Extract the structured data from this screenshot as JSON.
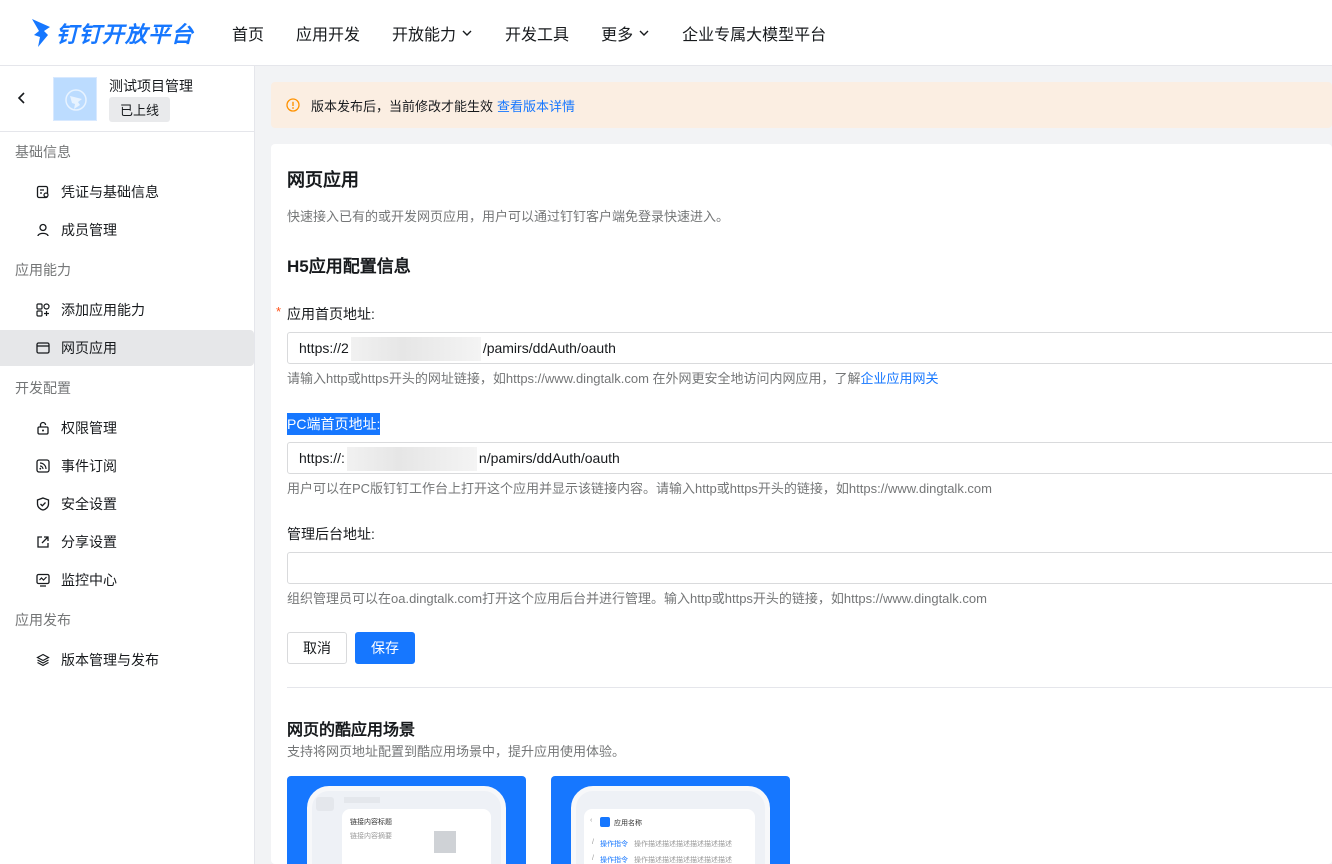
{
  "brand": {
    "name": "钉钉开放平台",
    "color": "#1677ff"
  },
  "topnav": {
    "items": [
      {
        "label": "首页",
        "dropdown": false
      },
      {
        "label": "应用开发",
        "dropdown": false
      },
      {
        "label": "开放能力",
        "dropdown": true
      },
      {
        "label": "开发工具",
        "dropdown": false
      },
      {
        "label": "更多",
        "dropdown": true
      },
      {
        "label": "企业专属大模型平台",
        "dropdown": false
      }
    ]
  },
  "sidebar": {
    "app_name": "测试项目管理",
    "app_status": "已上线",
    "groups": [
      {
        "title": "基础信息",
        "items": [
          {
            "label": "凭证与基础信息",
            "icon": "credential-icon"
          },
          {
            "label": "成员管理",
            "icon": "user-icon"
          }
        ]
      },
      {
        "title": "应用能力",
        "items": [
          {
            "label": "添加应用能力",
            "icon": "add-capability-icon"
          },
          {
            "label": "网页应用",
            "icon": "browser-icon",
            "active": true
          }
        ]
      },
      {
        "title": "开发配置",
        "items": [
          {
            "label": "权限管理",
            "icon": "lock-icon"
          },
          {
            "label": "事件订阅",
            "icon": "rss-icon"
          },
          {
            "label": "安全设置",
            "icon": "shield-icon"
          },
          {
            "label": "分享设置",
            "icon": "share-icon"
          },
          {
            "label": "监控中心",
            "icon": "monitor-icon"
          }
        ]
      },
      {
        "title": "应用发布",
        "items": [
          {
            "label": "版本管理与发布",
            "icon": "layers-icon"
          }
        ]
      }
    ]
  },
  "banner": {
    "text": "版本发布后，当前修改才能生效",
    "link": "查看版本详情"
  },
  "page": {
    "title": "网页应用",
    "desc": "快速接入已有的或开发网页应用，用户可以通过钉钉客户端免登录快速进入。",
    "section_title": "H5应用配置信息",
    "fields": {
      "home": {
        "label": "应用首页地址:",
        "value_prefix": "https://2",
        "value_suffix": "/pamirs/ddAuth/oauth",
        "hint": "请输入http或https开头的网址链接，如https://www.dingtalk.com 在外网更安全地访问内网应用，了解",
        "hint_link": "企业应用网关"
      },
      "pc": {
        "label": "PC端首页地址:",
        "value_prefix": "https://:",
        "value_suffix": "n/pamirs/ddAuth/oauth",
        "hint": "用户可以在PC版钉钉工作台上打开这个应用并显示该链接内容。请输入http或https开头的链接，如https://www.dingtalk.com"
      },
      "admin": {
        "label": "管理后台地址:",
        "value": "",
        "hint": "组织管理员可以在oa.dingtalk.com打开这个应用后台并进行管理。输入http或https开头的链接，如https://www.dingtalk.com"
      }
    },
    "buttons": {
      "cancel": "取消",
      "save": "保存"
    },
    "scene": {
      "title": "网页的酷应用场景",
      "desc": "支持将网页地址配置到酷应用场景中，提升应用使用体验。",
      "card1": {
        "title": "链接内容标题",
        "sub": "链接内容摘要"
      },
      "card2": {
        "app_name": "应用名称",
        "cmd": "操作指令",
        "cmd_desc": "操作描述描述描述描述描述描述"
      }
    }
  }
}
